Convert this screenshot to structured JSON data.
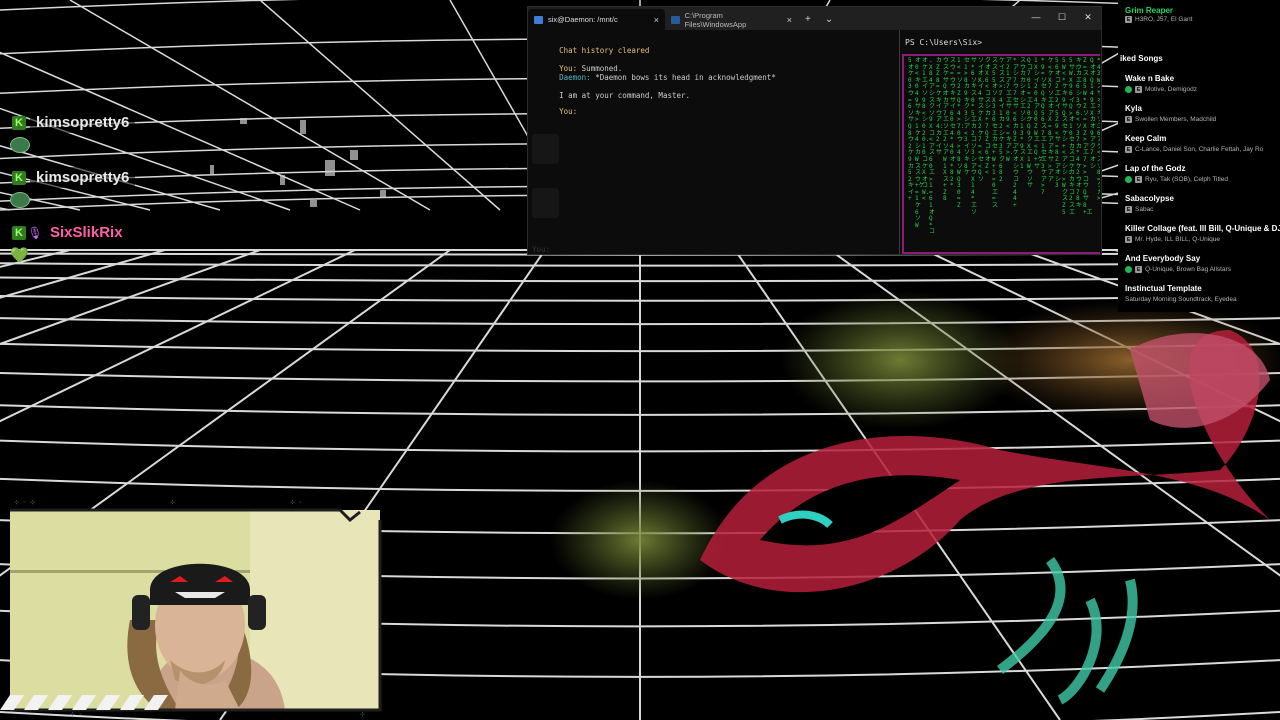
{
  "chat": {
    "messages": [
      {
        "user": "kimsopretty6",
        "color": "#e8e8e8"
      },
      {
        "user": "kimsopretty6",
        "color": "#e8e8e8"
      },
      {
        "user": "SixSlikRix",
        "color": "#ff5fa8"
      }
    ],
    "heart": "💚",
    "sub_badge": "K"
  },
  "terminal": {
    "tabs": [
      {
        "label": "six@Daemon: /mnt/c",
        "close": "×"
      },
      {
        "label": "C:\\Program Files\\WindowsApp",
        "close": "×"
      }
    ],
    "new_tab": "+",
    "dropdown": "⌄",
    "window_controls": {
      "minimize": "—",
      "maximize": "☐",
      "close": "✕"
    },
    "left_lines": [
      {
        "text": "Chat history cleared",
        "color": "#e5c07b"
      },
      {
        "speaker": "You:",
        "text": "Summoned.",
        "speaker_color": "#e5c07b",
        "color": "#cccccc"
      },
      {
        "speaker": "Daemon:",
        "text": "*Daemon bows its head in acknowledgment*",
        "speaker_color": "#56b6c2",
        "color": "#cccccc"
      },
      {
        "text": "I am at your command, Master.",
        "color": "#cccccc"
      },
      {
        "speaker": "You:",
        "text": "",
        "speaker_color": "#e5c07b",
        "color": "#cccccc"
      }
    ],
    "faded_prompt": "You:",
    "ps_prompt": "PS C:\\Users\\Six>"
  },
  "songs": {
    "top": {
      "title": "Grim Reaper",
      "artist": "H3RO, J57, El Gant",
      "title_color": "#1ed760"
    },
    "section_label": "iked Songs",
    "items": [
      {
        "title": "Wake n Bake",
        "artist": "Motive, Demigodz",
        "explicit": true,
        "downloaded": true
      },
      {
        "title": "Kyla",
        "artist": "Swollen Members, Madchild",
        "explicit": true,
        "downloaded": false
      },
      {
        "title": "Keep Calm",
        "artist": "C-Lance, Daniel Son, Charlie Fettah, Jay Ro",
        "explicit": true,
        "downloaded": false
      },
      {
        "title": "Lap of the Godz",
        "artist": "Ryu, Tak (SOB), Celph Titled",
        "explicit": true,
        "downloaded": true
      },
      {
        "title": "Sabacolypse",
        "artist": "Sabac",
        "explicit": true,
        "downloaded": false
      },
      {
        "title": "Killer Collage (feat. Ill Bill, Q-Unique & DJ",
        "artist": "Mr. Hyde, ILL BILL, Q-Unique",
        "explicit": true,
        "downloaded": false
      },
      {
        "title": "And Everybody Say",
        "artist": "Q-Unique, Brown Bag Allstars",
        "explicit": true,
        "downloaded": false
      },
      {
        "title": "Instinctual Template",
        "artist": "Saturday Morning Soundtrack, Eyedea",
        "explicit": false,
        "downloaded": false
      }
    ]
  },
  "colors": {
    "grid": "#d9d9d9",
    "matrix_green": "#25d04a",
    "matrix_border": "#8c1a7a",
    "spotify_green": "#1db954"
  },
  "icons": {
    "terminal_tab": "linux-terminal-icon",
    "powershell_tab": "powershell-icon",
    "webcam": "webcam-feed"
  }
}
